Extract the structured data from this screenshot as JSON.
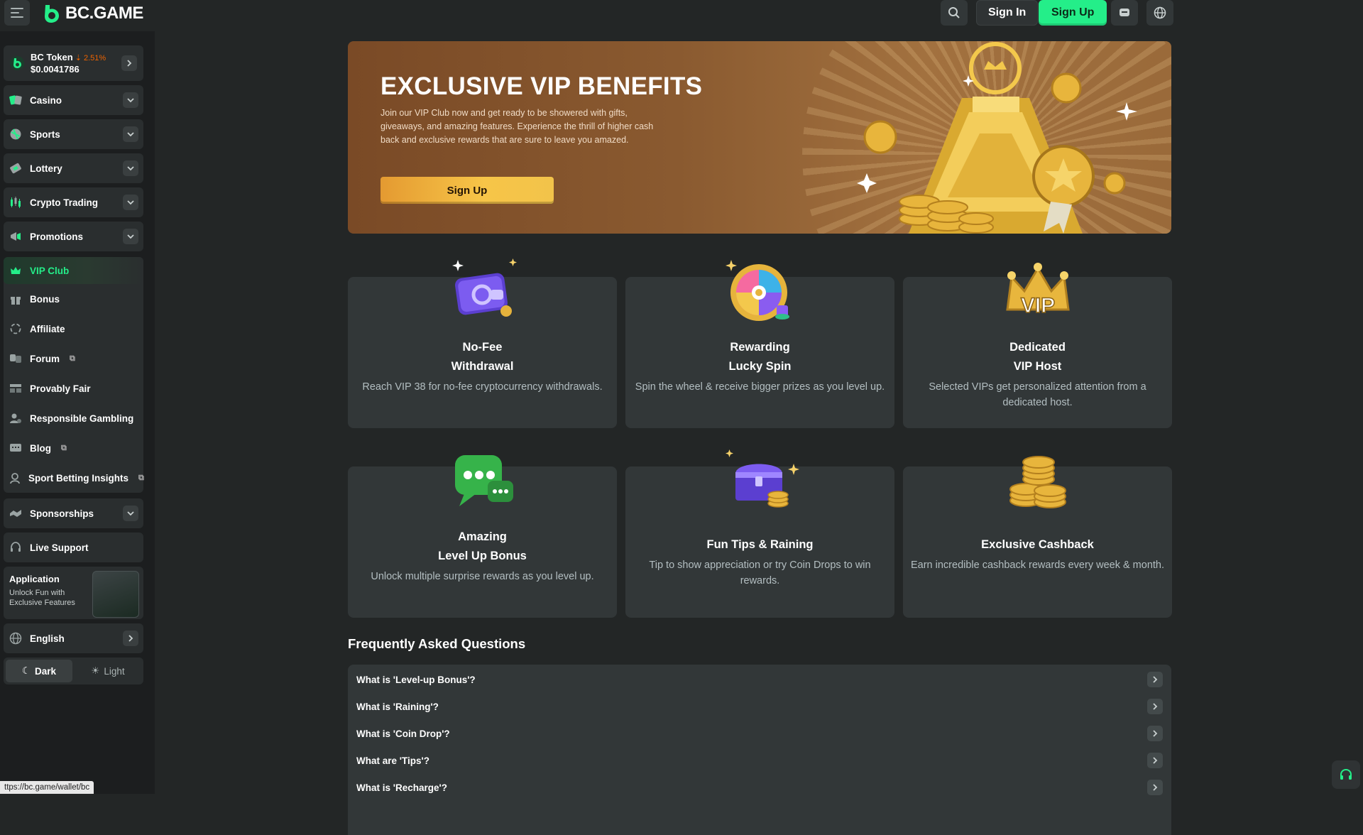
{
  "brand": {
    "name": "BC.GAME",
    "accent": "#24ee89"
  },
  "topbar": {
    "signin_label": "Sign In",
    "signup_label": "Sign Up"
  },
  "sidebar": {
    "token": {
      "name": "BC Token",
      "change": "2.51%",
      "price": "$0.0041786"
    },
    "groups": [
      {
        "label": "Casino"
      },
      {
        "label": "Sports"
      },
      {
        "label": "Lottery"
      },
      {
        "label": "Crypto Trading"
      },
      {
        "label": "Promotions"
      }
    ],
    "links": [
      {
        "label": "VIP Club"
      },
      {
        "label": "Bonus"
      },
      {
        "label": "Affiliate"
      },
      {
        "label": "Forum"
      },
      {
        "label": "Provably Fair"
      },
      {
        "label": "Responsible Gambling"
      },
      {
        "label": "Blog"
      },
      {
        "label": "Sport Betting Insights"
      }
    ],
    "sponsorships": "Sponsorships",
    "live_support": "Live Support",
    "app": {
      "title": "Application",
      "subtitle": "Unlock Fun with Exclusive Features"
    },
    "language": "English",
    "theme": {
      "dark": "Dark",
      "light": "Light"
    }
  },
  "hero": {
    "title": "EXCLUSIVE VIP BENEFITS",
    "description": "Join our VIP Club now and get ready to be showered with gifts, giveaways, and amazing features. Experience the thrill of higher cash back and exclusive rewards that are sure to leave you amazed.",
    "button": "Sign Up"
  },
  "benefits": [
    {
      "title_line1": "No-Fee",
      "title_line2": "Withdrawal",
      "desc": "Reach VIP 38 for no-fee cryptocurrency withdrawals."
    },
    {
      "title_line1": "Rewarding",
      "title_line2": "Lucky Spin",
      "desc": "Spin the wheel & receive bigger prizes as you level up."
    },
    {
      "title_line1": "Dedicated",
      "title_line2": "VIP Host",
      "desc": "Selected VIPs get personalized attention from a dedicated host."
    },
    {
      "title_line1": "Amazing",
      "title_line2": "Level Up Bonus",
      "desc": "Unlock multiple surprise rewards as you level up."
    },
    {
      "title_line1": "Fun Tips & Raining",
      "title_line2": "",
      "desc": "Tip to show appreciation or try Coin Drops to win rewards."
    },
    {
      "title_line1": "Exclusive Cashback",
      "title_line2": "",
      "desc": "Earn incredible cashback rewards every week & month."
    }
  ],
  "faq": {
    "title": "Frequently Asked Questions",
    "items": [
      "What is 'Level-up Bonus'?",
      "What is 'Raining'?",
      "What is 'Coin Drop'?",
      "What are 'Tips'?",
      "What is 'Recharge'?"
    ]
  },
  "status_url": "ttps://bc.game/wallet/bc"
}
